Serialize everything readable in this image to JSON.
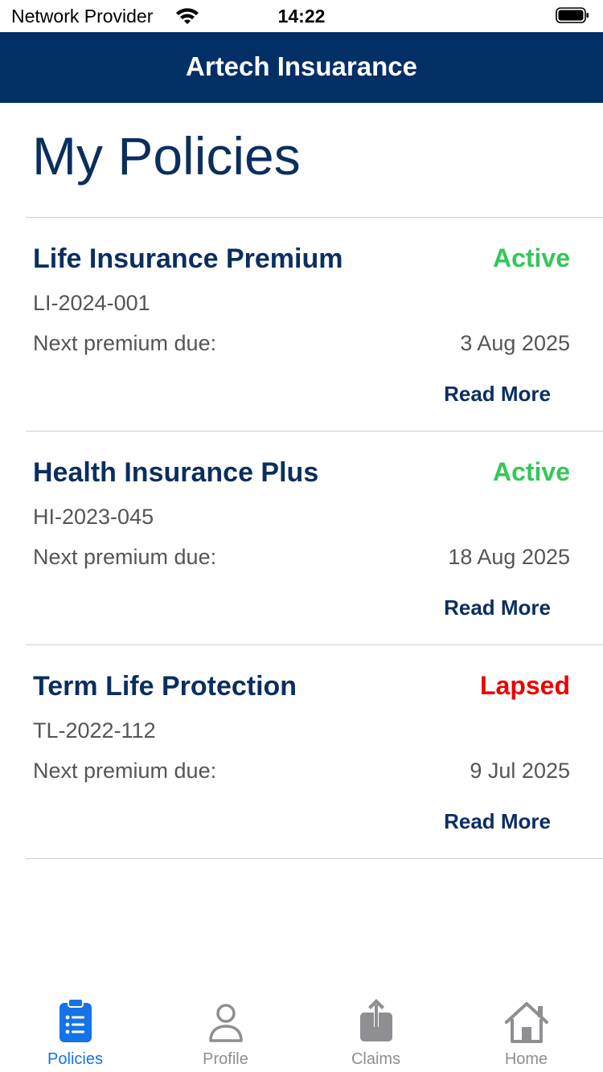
{
  "status_bar": {
    "carrier": "Network Provider",
    "time": "14:22",
    "icons": [
      "wifi-icon",
      "battery-icon"
    ]
  },
  "header": {
    "title": "Artech Insuarance",
    "background": "#022f66"
  },
  "page": {
    "title": "My Policies"
  },
  "colors": {
    "active": "#34c759",
    "lapsed": "#ee0000",
    "brand": "#0b2e5f",
    "tab_active": "#1473e6",
    "tab_inactive": "#8e8e93"
  },
  "policies": [
    {
      "name": "Life Insurance Premium",
      "status": "Active",
      "number": "LI-2024-001",
      "due_label": "Next premium due:",
      "due_date": "3 Aug 2025",
      "action": "Read More"
    },
    {
      "name": "Health Insurance Plus",
      "status": "Active",
      "number": "HI-2023-045",
      "due_label": "Next premium due:",
      "due_date": "18 Aug 2025",
      "action": "Read More"
    },
    {
      "name": "Term Life Protection",
      "status": "Lapsed",
      "number": "TL-2022-112",
      "due_label": "Next premium due:",
      "due_date": "9 Jul 2025",
      "action": "Read More"
    }
  ],
  "tabs": [
    {
      "label": "Policies",
      "icon": "clipboard-list-icon",
      "active": true
    },
    {
      "label": "Profile",
      "icon": "person-icon",
      "active": false
    },
    {
      "label": "Claims",
      "icon": "share-upload-icon",
      "active": false
    },
    {
      "label": "Home",
      "icon": "house-icon",
      "active": false
    }
  ]
}
